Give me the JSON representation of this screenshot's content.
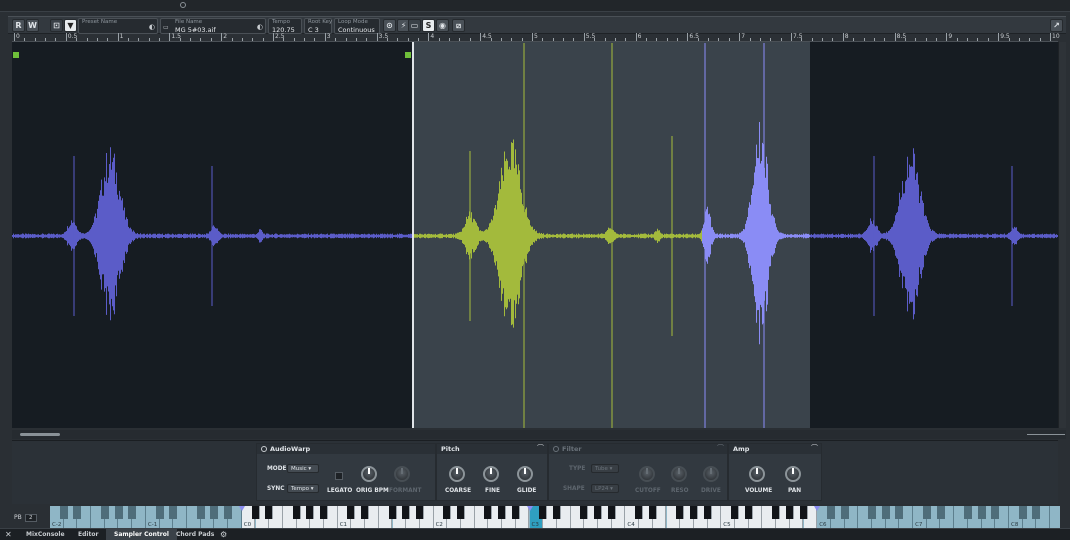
{
  "toolbar": {
    "buttons": [
      "R",
      "W"
    ],
    "preset_name_label": "Preset Name",
    "preset_name_value": "",
    "file_name_label": "File Name",
    "file_name_value": "MG 5#03.aif",
    "tempo_label": "Tempo",
    "tempo_value": "120.75",
    "root_key_label": "Root Key",
    "root_key_value": "C 3",
    "loop_mode_label": "Loop Mode",
    "loop_mode_value": "Continuous",
    "tool_icons": [
      "loop-icon",
      "snap-icon",
      "scrub-icon",
      "mute-icon",
      "speaker-icon",
      "hitpoint-icon"
    ]
  },
  "ruler": {
    "labels": [
      "0",
      "0.5",
      "1",
      "1.5",
      "2",
      "2.5",
      "3",
      "3.5",
      "4",
      "4.5",
      "5",
      "5.5",
      "6",
      "6.5",
      "7",
      "7.5",
      "8",
      "8.5",
      "9",
      "9.5",
      "10"
    ]
  },
  "audiowarp": {
    "title": "AudioWarp",
    "mode_label": "MODE",
    "mode_value": "Music",
    "sync_label": "SYNC",
    "sync_value": "Tempo",
    "legato_label": "LEGATO",
    "orig_bpm_label": "ORIG BPM",
    "formant_label": "FORMANT"
  },
  "pitch": {
    "title": "Pitch",
    "coarse_label": "COARSE",
    "fine_label": "FINE",
    "glide_label": "GLIDE"
  },
  "filter": {
    "title": "Filter",
    "type_label": "TYPE",
    "type_value": "Tube",
    "shape_label": "SHAPE",
    "shape_value": "LP24",
    "cutoff_label": "CUTOFF",
    "reso_label": "RESO",
    "drive_label": "DRIVE"
  },
  "amp": {
    "title": "Amp",
    "volume_label": "VOLUME",
    "pan_label": "PAN"
  },
  "keyboard": {
    "pb_label": "PB",
    "pb_value": "2",
    "octave_labels": [
      "C-2",
      "C-1",
      "C0",
      "C1",
      "C2",
      "C3",
      "C4",
      "C5",
      "C6",
      "C7",
      "C8"
    ],
    "range_low": "C0",
    "range_root": "C3",
    "range_high": "C6"
  },
  "tabs": {
    "items": [
      "MixConsole",
      "Editor",
      "Sampler Control",
      "Chord Pads"
    ],
    "active": "Sampler Control"
  },
  "colors": {
    "waveform_outside": "#5b5cc8",
    "waveform_loop": "#a3ba3c",
    "waveform_loop_transient": "#8a8cf5",
    "loop_region_bg": "#3a434b",
    "accent_root_key": "#2f9fc0"
  }
}
